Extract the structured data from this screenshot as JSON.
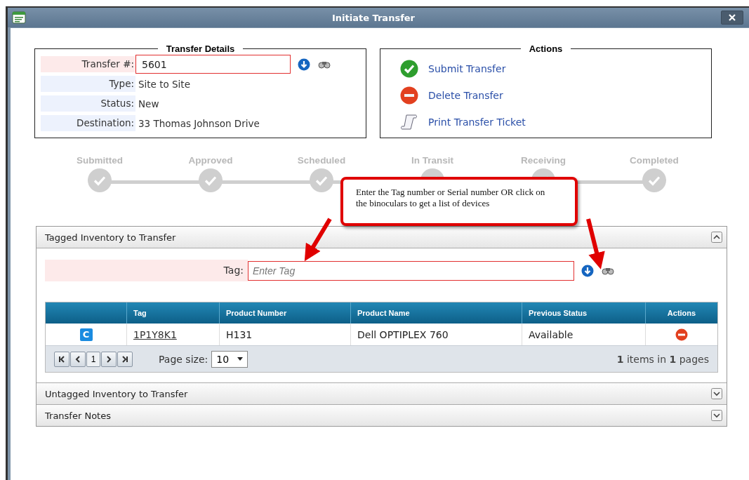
{
  "window": {
    "title": "Initiate Transfer"
  },
  "transfer_details": {
    "title": "Transfer Details",
    "rows": [
      {
        "kind": "input",
        "label": "Transfer #:",
        "value": "5601",
        "required": true
      },
      {
        "kind": "text",
        "label": "Type:",
        "value": "Site to Site",
        "required": false
      },
      {
        "kind": "text",
        "label": "Status:",
        "value": "New",
        "required": false
      },
      {
        "kind": "text",
        "label": "Destination:",
        "value": "33 Thomas Johnson Drive",
        "required": false
      }
    ]
  },
  "actions": {
    "title": "Actions",
    "items": [
      {
        "kind": "submit",
        "label": "Submit Transfer"
      },
      {
        "kind": "delete",
        "label": "Delete Transfer"
      },
      {
        "kind": "print",
        "label": "Print Transfer Ticket"
      }
    ]
  },
  "steps": [
    {
      "label": "Submitted"
    },
    {
      "label": "Approved"
    },
    {
      "label": "Scheduled"
    },
    {
      "label": "In Transit"
    },
    {
      "label": "Receiving"
    },
    {
      "label": "Completed"
    }
  ],
  "callout": {
    "text": "Enter the Tag number or Serial number OR click on the binoculars to get a list of devices"
  },
  "panels": [
    {
      "title": "Tagged Inventory to Transfer",
      "expanded": true
    },
    {
      "title": "Untagged Inventory to Transfer",
      "expanded": false
    },
    {
      "title": "Transfer Notes",
      "expanded": false
    }
  ],
  "tag_field": {
    "label": "Tag:",
    "placeholder": "Enter Tag",
    "required": true
  },
  "table": {
    "columns": [
      "",
      "Tag",
      "Product Number",
      "Product Name",
      "Previous Status",
      "Actions"
    ],
    "rows": [
      {
        "badge": "C",
        "tag": "1P1Y8K1",
        "product_number": "H131",
        "product_name": "Dell OPTIPLEX 760",
        "previous_status": "Available"
      }
    ]
  },
  "pager": {
    "page": "1",
    "page_size_label": "Page size:",
    "page_size": "10",
    "summary": "**1** items in **1** pages"
  }
}
